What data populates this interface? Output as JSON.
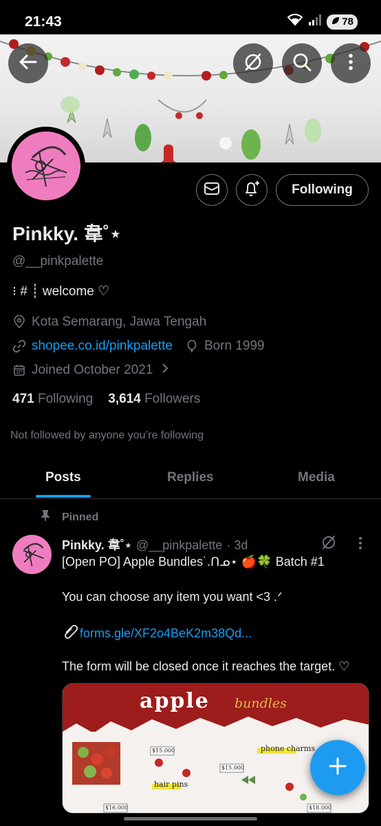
{
  "status_bar": {
    "time": "21:43",
    "battery": "78"
  },
  "profile": {
    "display_name": "Pinkky. ⾱˚⋆",
    "handle": "@__pinkpalette",
    "bio": "⁝ # ┊ welcome ♡",
    "location": "Kota Semarang, Jawa Tengah",
    "website": "shopee.co.id/pinkpalette",
    "birthday": "Born 1999",
    "joined": "Joined October 2021",
    "following_count": "471",
    "following_label": "Following",
    "followers_count": "3,614",
    "followers_label": "Followers",
    "not_followed_note": "Not followed by anyone you’re following",
    "follow_button": "Following"
  },
  "tabs": [
    {
      "label": "Posts",
      "active": true
    },
    {
      "label": "Replies",
      "active": false
    },
    {
      "label": "Media",
      "active": false
    }
  ],
  "pinned_post": {
    "pinned_label": "Pinned",
    "author_name": "Pinkky. ⾱˚⋆",
    "author_handle": "@__pinkpalette",
    "time": "· 3d",
    "line1": "[Open PO] Apple Bundles˙.ᑎᓄ⋆ 🍎🍀 Batch #1",
    "line2": "You can choose any item you want <3 .ᐟ",
    "link": "forms.gle/XF2o4BeK2m38Qd...",
    "line3": "The form will be closed once it reaches the target. ♡",
    "image": {
      "title": "apple",
      "subtitle": "bundles",
      "labels": [
        "phone charms",
        "hair pins"
      ],
      "prices": [
        "$15.000",
        "$15.000",
        "$16.000",
        "$18.000"
      ]
    }
  },
  "colors": {
    "accent": "#1d9bf0",
    "background": "#000000",
    "avatar_pink": "#f07cc0"
  }
}
